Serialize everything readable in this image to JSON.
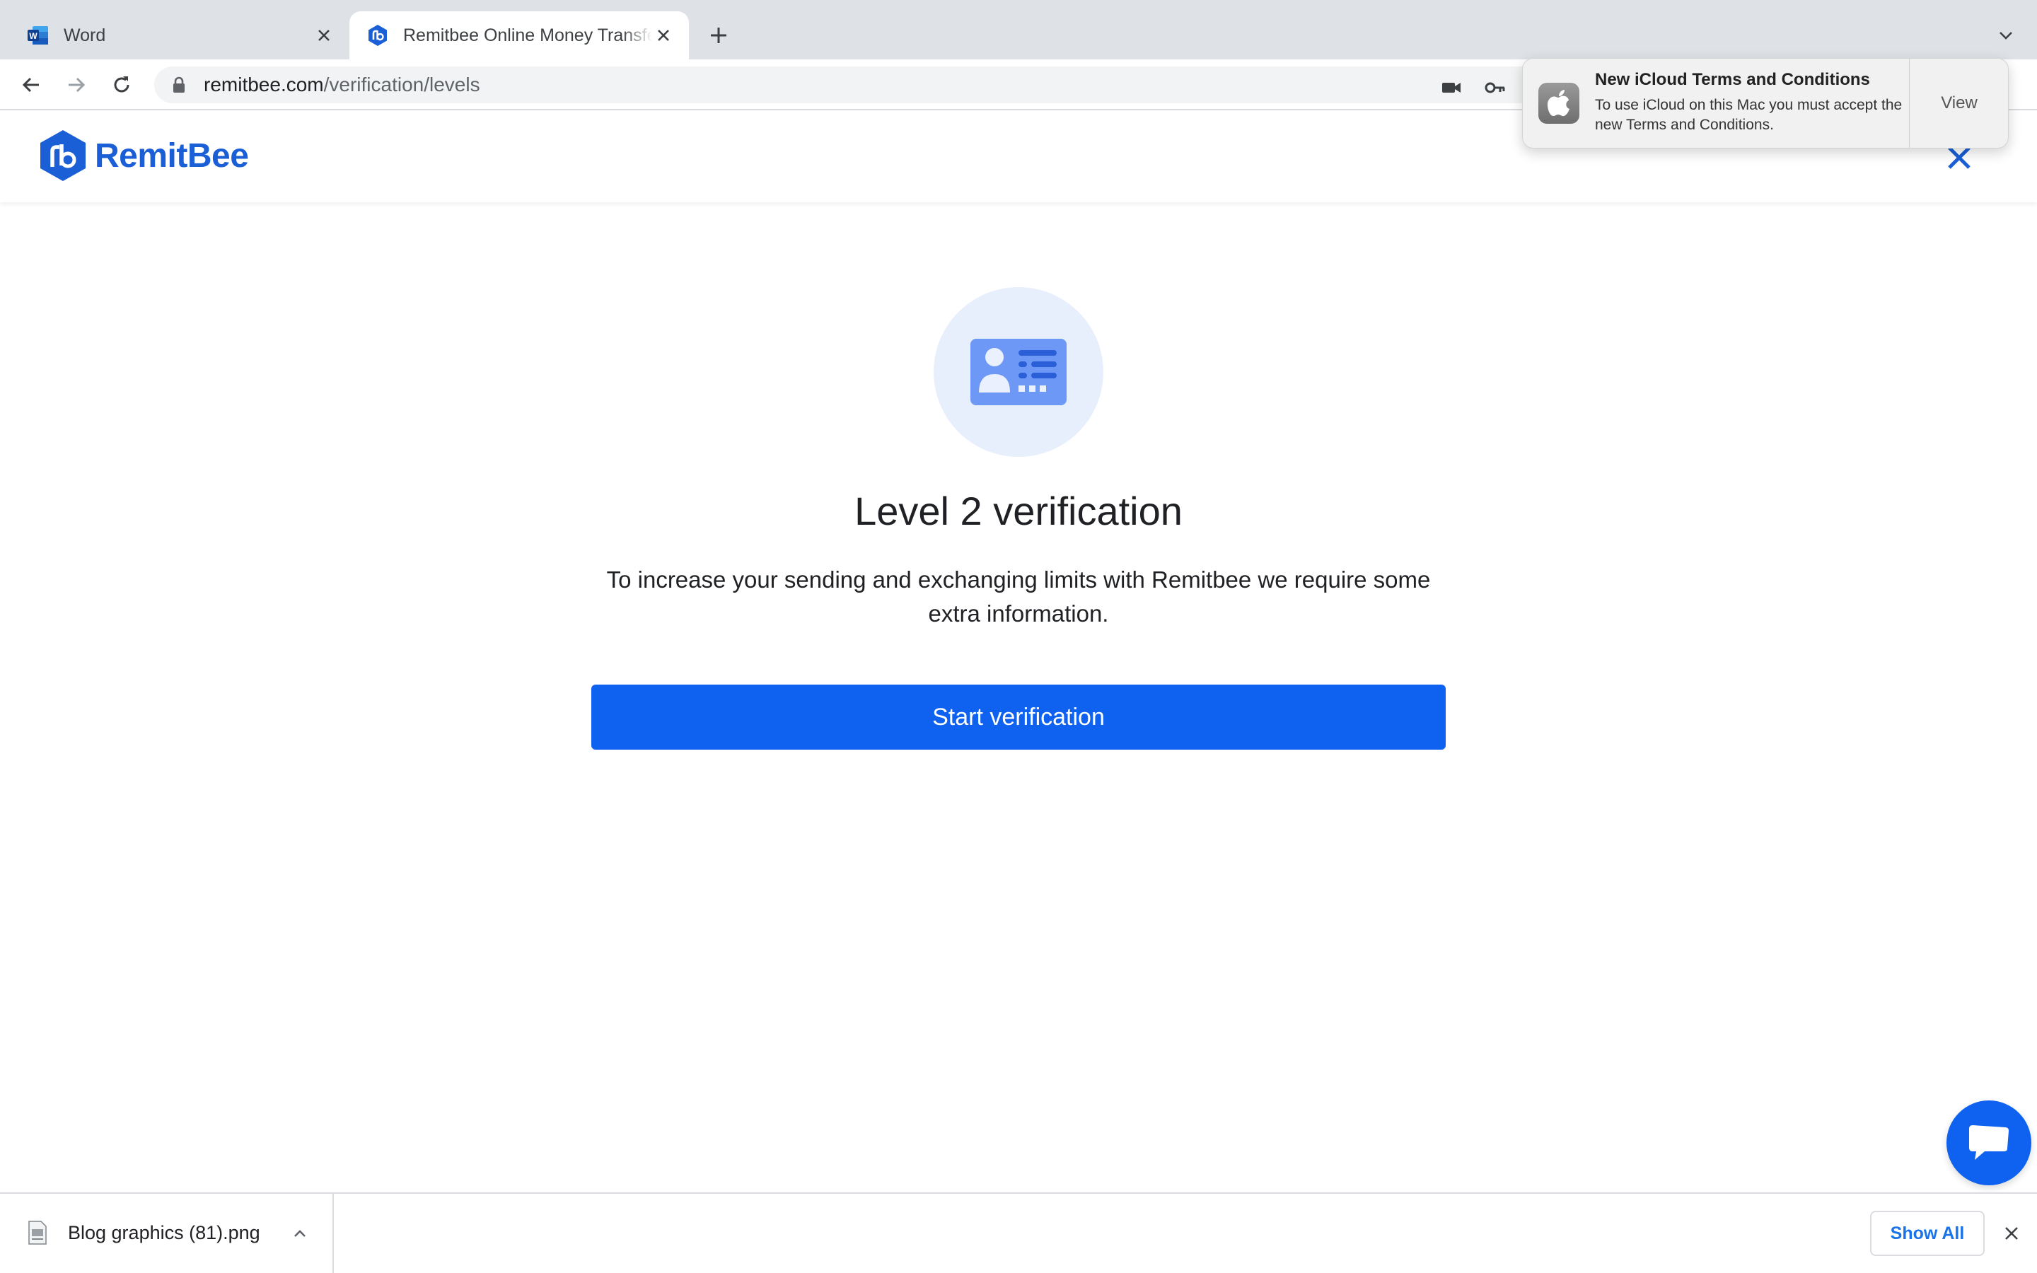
{
  "browser": {
    "tabs": [
      {
        "title": "Word",
        "icon": "word-icon",
        "active": false
      },
      {
        "title": "Remitbee Online Money Transfer",
        "icon": "remitbee-icon",
        "active": true
      }
    ],
    "address_bar": {
      "domain": "remitbee.com",
      "path": "/verification/levels"
    }
  },
  "site": {
    "brand": "RemitBee",
    "brand_color": "#1a5fd6"
  },
  "main": {
    "icon": "id-card-icon",
    "heading": "Level 2 verification",
    "description": "To increase your sending and exchanging limits with Remitbee we require some extra information.",
    "start_button_label": "Start verification",
    "accent_color": "#0f62f0"
  },
  "notification": {
    "title": "New iCloud Terms and Conditions",
    "body": "To use iCloud on this Mac you must accept the new Terms and Conditions.",
    "action_label": "View"
  },
  "downloads": {
    "items": [
      {
        "filename": "Blog graphics (81).png"
      }
    ],
    "show_all_label": "Show All"
  }
}
